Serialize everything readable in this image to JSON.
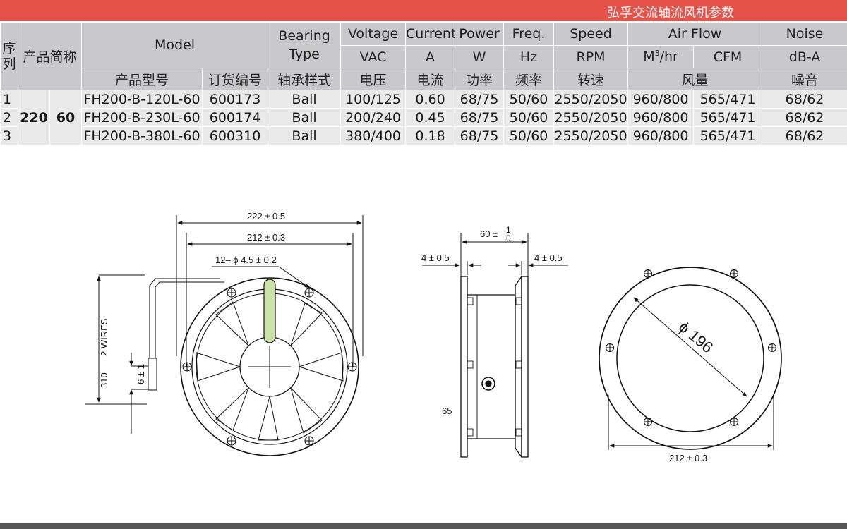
{
  "title": "弘孚交流轴流风机参数",
  "table": {
    "headers": {
      "seq": "序列",
      "short_name": "产品简称",
      "model": "Model",
      "bearing_type": "Bearing Type",
      "voltage": "Voltage",
      "current": "Current",
      "power": "Power",
      "freq": "Freq.",
      "speed": "Speed",
      "airflow": "Air Flow",
      "noise": "Noise"
    },
    "units": {
      "voltage": "VAC",
      "current": "A",
      "power": "W",
      "freq": "Hz",
      "speed": "RPM",
      "airflow_m3_base": "M",
      "airflow_m3_sup": "3",
      "airflow_m3_rest": "/hr",
      "airflow_cfm": "CFM",
      "noise": "dB-A"
    },
    "cn_headers": {
      "model": "产品型号",
      "order_no": "订货编号",
      "bearing": "轴承样式",
      "voltage": "电压",
      "current": "电流",
      "power": "功率",
      "freq": "频率",
      "speed": "转速",
      "airflow": "风量",
      "noise": "噪音"
    },
    "short_name_values": [
      "220",
      "60"
    ],
    "rows": [
      {
        "seq": "1",
        "model": "FH200-B-120L-60",
        "order_no": "600173",
        "bearing": "Ball",
        "voltage": "100/125",
        "current": "0.60",
        "power": "68/75",
        "freq": "50/60",
        "speed": "2550/2050",
        "m3hr": "960/800",
        "cfm": "565/471",
        "noise": "68/62"
      },
      {
        "seq": "2",
        "model": "FH200-B-230L-60",
        "order_no": "600174",
        "bearing": "Ball",
        "voltage": "200/240",
        "current": "0.45",
        "power": "68/75",
        "freq": "50/60",
        "speed": "2550/2050",
        "m3hr": "960/800",
        "cfm": "565/471",
        "noise": "68/62"
      },
      {
        "seq": "3",
        "model": "FH200-B-380L-60",
        "order_no": "600310",
        "bearing": "Ball",
        "voltage": "380/400",
        "current": "0.18",
        "power": "68/75",
        "freq": "50/60",
        "speed": "2550/2050",
        "m3hr": "960/800",
        "cfm": "565/471",
        "noise": "68/62"
      }
    ]
  },
  "drawing": {
    "dim_222": "222 ± 0.5",
    "dim_212_top": "212 ± 0.3",
    "holes": "12– ϕ 4.5 ± 0.2",
    "wires": "2 WIRES",
    "dim_310": "310",
    "dim_6": "6 ± 1",
    "dim_60_base": "60 ±",
    "dim_60_upper": "1",
    "dim_60_lower": "0",
    "dim_4_left": "4 ± 0.5",
    "dim_4_right": "4 ± 0.5",
    "dim_65": "65",
    "dim_196": "ϕ 196",
    "dim_212_bottom": "212 ± 0.3"
  }
}
